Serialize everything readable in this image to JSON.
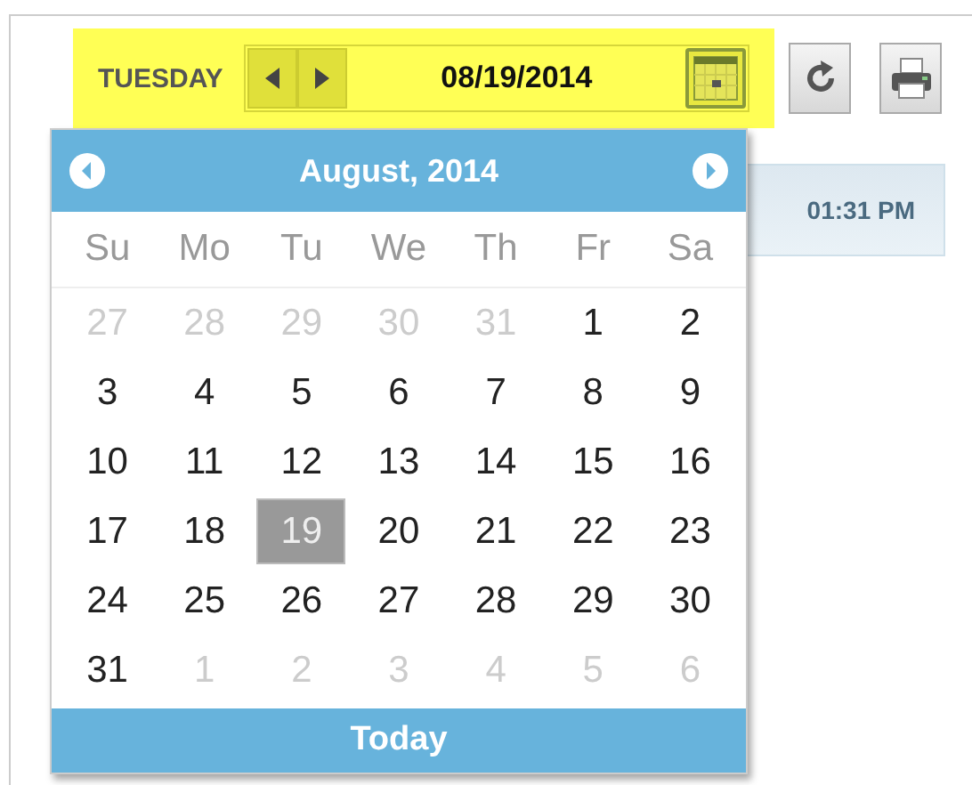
{
  "toolbar": {
    "day_name": "TUESDAY",
    "date_value": "08/19/2014"
  },
  "background_row": {
    "time": "01:31 PM"
  },
  "calendar": {
    "title": "August, 2014",
    "weekdays": [
      "Su",
      "Mo",
      "Tu",
      "We",
      "Th",
      "Fr",
      "Sa"
    ],
    "weeks": [
      [
        {
          "label": "27",
          "muted": true,
          "selected": false
        },
        {
          "label": "28",
          "muted": true,
          "selected": false
        },
        {
          "label": "29",
          "muted": true,
          "selected": false
        },
        {
          "label": "30",
          "muted": true,
          "selected": false
        },
        {
          "label": "31",
          "muted": true,
          "selected": false
        },
        {
          "label": "1",
          "muted": false,
          "selected": false
        },
        {
          "label": "2",
          "muted": false,
          "selected": false
        }
      ],
      [
        {
          "label": "3",
          "muted": false,
          "selected": false
        },
        {
          "label": "4",
          "muted": false,
          "selected": false
        },
        {
          "label": "5",
          "muted": false,
          "selected": false
        },
        {
          "label": "6",
          "muted": false,
          "selected": false
        },
        {
          "label": "7",
          "muted": false,
          "selected": false
        },
        {
          "label": "8",
          "muted": false,
          "selected": false
        },
        {
          "label": "9",
          "muted": false,
          "selected": false
        }
      ],
      [
        {
          "label": "10",
          "muted": false,
          "selected": false
        },
        {
          "label": "11",
          "muted": false,
          "selected": false
        },
        {
          "label": "12",
          "muted": false,
          "selected": false
        },
        {
          "label": "13",
          "muted": false,
          "selected": false
        },
        {
          "label": "14",
          "muted": false,
          "selected": false
        },
        {
          "label": "15",
          "muted": false,
          "selected": false
        },
        {
          "label": "16",
          "muted": false,
          "selected": false
        }
      ],
      [
        {
          "label": "17",
          "muted": false,
          "selected": false
        },
        {
          "label": "18",
          "muted": false,
          "selected": false
        },
        {
          "label": "19",
          "muted": false,
          "selected": true
        },
        {
          "label": "20",
          "muted": false,
          "selected": false
        },
        {
          "label": "21",
          "muted": false,
          "selected": false
        },
        {
          "label": "22",
          "muted": false,
          "selected": false
        },
        {
          "label": "23",
          "muted": false,
          "selected": false
        }
      ],
      [
        {
          "label": "24",
          "muted": false,
          "selected": false
        },
        {
          "label": "25",
          "muted": false,
          "selected": false
        },
        {
          "label": "26",
          "muted": false,
          "selected": false
        },
        {
          "label": "27",
          "muted": false,
          "selected": false
        },
        {
          "label": "28",
          "muted": false,
          "selected": false
        },
        {
          "label": "29",
          "muted": false,
          "selected": false
        },
        {
          "label": "30",
          "muted": false,
          "selected": false
        }
      ],
      [
        {
          "label": "31",
          "muted": false,
          "selected": false
        },
        {
          "label": "1",
          "muted": true,
          "selected": false
        },
        {
          "label": "2",
          "muted": true,
          "selected": false
        },
        {
          "label": "3",
          "muted": true,
          "selected": false
        },
        {
          "label": "4",
          "muted": true,
          "selected": false
        },
        {
          "label": "5",
          "muted": true,
          "selected": false
        },
        {
          "label": "6",
          "muted": true,
          "selected": false
        }
      ]
    ],
    "today_button": "Today"
  }
}
